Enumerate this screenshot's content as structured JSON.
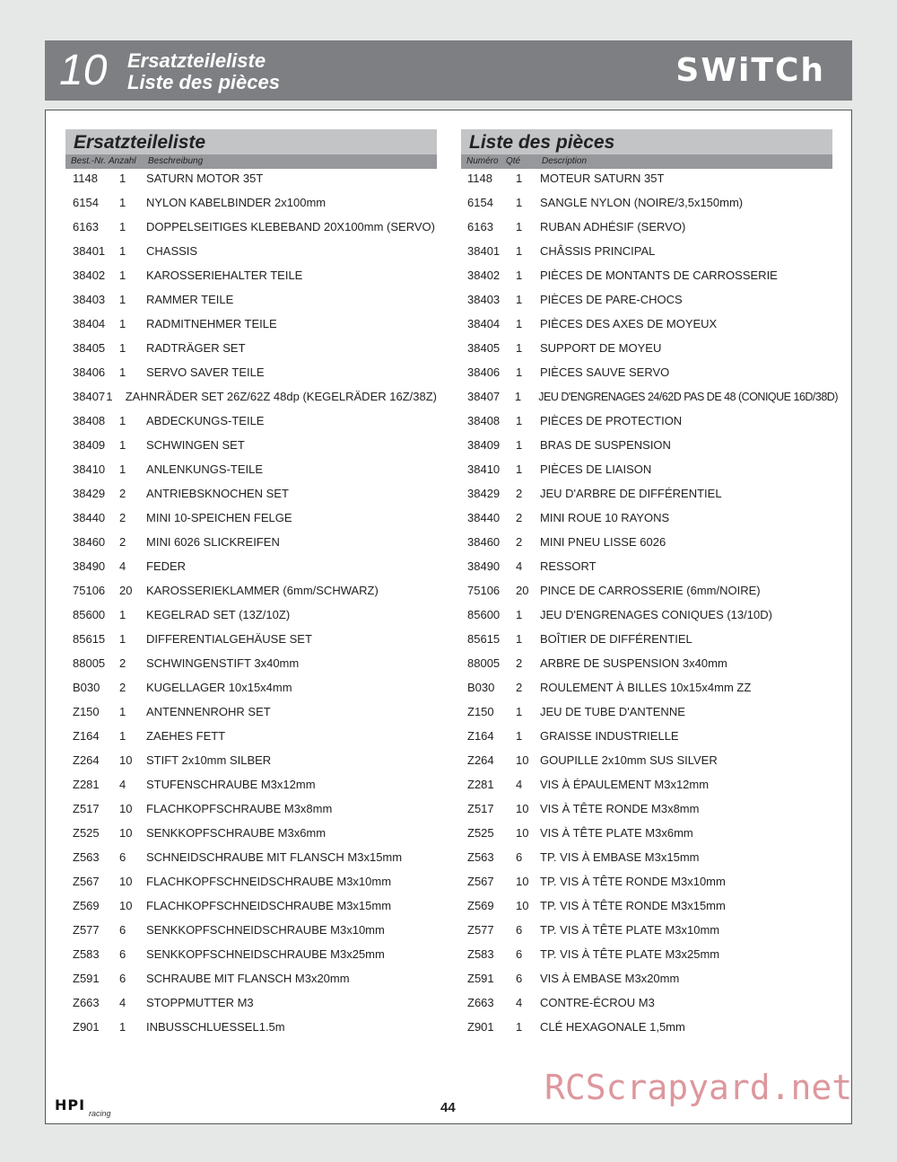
{
  "header": {
    "chapter_number": "10",
    "title_de": "Ersatzteileliste",
    "title_fr": "Liste des pièces",
    "brand": "SWiTCh"
  },
  "german": {
    "section_title": "Ersatzteileliste",
    "columns": [
      "Best.-Nr.",
      "Anzahl",
      "Beschreibung"
    ],
    "rows": [
      [
        "1148",
        "1",
        "SATURN MOTOR 35T"
      ],
      [
        "6154",
        "1",
        "NYLON KABELBINDER 2x100mm"
      ],
      [
        "6163",
        "1",
        "DOPPELSEITIGES KLEBEBAND 20X100mm (SERVO)"
      ],
      [
        "38401",
        "1",
        "CHASSIS"
      ],
      [
        "38402",
        "1",
        "KAROSSERIEHALTER TEILE"
      ],
      [
        "38403",
        "1",
        "RAMMER TEILE"
      ],
      [
        "38404",
        "1",
        "RADMITNEHMER TEILE"
      ],
      [
        "38405",
        "1",
        "RADTRÄGER SET"
      ],
      [
        "38406",
        "1",
        "SERVO SAVER TEILE"
      ],
      [
        "38407",
        "1",
        "ZAHNRÄDER SET 26Z/62Z 48dp (KEGELRÄDER 16Z/38Z)"
      ],
      [
        "38408",
        "1",
        "ABDECKUNGS-TEILE"
      ],
      [
        "38409",
        "1",
        "SCHWINGEN SET"
      ],
      [
        "38410",
        "1",
        "ANLENKUNGS-TEILE"
      ],
      [
        "38429",
        "2",
        "ANTRIEBSKNOCHEN SET"
      ],
      [
        "38440",
        "2",
        "MINI 10-SPEICHEN FELGE"
      ],
      [
        "38460",
        "2",
        "MINI 6026 SLICKREIFEN"
      ],
      [
        "38490",
        "4",
        "FEDER"
      ],
      [
        "75106",
        "20",
        "KAROSSERIEKLAMMER (6mm/SCHWARZ)"
      ],
      [
        "85600",
        "1",
        "KEGELRAD SET (13Z/10Z)"
      ],
      [
        "85615",
        "1",
        "DIFFERENTIALGEHÄUSE SET"
      ],
      [
        "88005",
        "2",
        "SCHWINGENSTIFT 3x40mm"
      ],
      [
        "B030",
        "2",
        "KUGELLAGER 10x15x4mm"
      ],
      [
        "Z150",
        "1",
        "ANTENNENROHR SET"
      ],
      [
        "Z164",
        "1",
        "ZAEHES FETT"
      ],
      [
        "Z264",
        "10",
        "STIFT 2x10mm SILBER"
      ],
      [
        "Z281",
        "4",
        "STUFENSCHRAUBE M3x12mm"
      ],
      [
        "Z517",
        "10",
        "FLACHKOPFSCHRAUBE M3x8mm"
      ],
      [
        "Z525",
        "10",
        "SENKKOPFSCHRAUBE M3x6mm"
      ],
      [
        "Z563",
        "6",
        "SCHNEIDSCHRAUBE MIT FLANSCH M3x15mm"
      ],
      [
        "Z567",
        "10",
        "FLACHKOPFSCHNEIDSCHRAUBE M3x10mm"
      ],
      [
        "Z569",
        "10",
        "FLACHKOPFSCHNEIDSCHRAUBE M3x15mm"
      ],
      [
        "Z577",
        "6",
        "SENKKOPFSCHNEIDSCHRAUBE M3x10mm"
      ],
      [
        "Z583",
        "6",
        "SENKKOPFSCHNEIDSCHRAUBE M3x25mm"
      ],
      [
        "Z591",
        "6",
        "SCHRAUBE MIT FLANSCH M3x20mm"
      ],
      [
        "Z663",
        "4",
        "STOPPMUTTER M3"
      ],
      [
        "Z901",
        "1",
        "INBUSSCHLUESSEL1.5m"
      ]
    ]
  },
  "french": {
    "section_title": "Liste des pièces",
    "columns": [
      "Numéro",
      "Qté",
      "Description"
    ],
    "rows": [
      [
        "1148",
        "1",
        "MOTEUR SATURN 35T"
      ],
      [
        "6154",
        "1",
        "SANGLE NYLON (NOIRE/3,5x150mm)"
      ],
      [
        "6163",
        "1",
        "RUBAN ADHÉSIF (SERVO)"
      ],
      [
        "38401",
        "1",
        "CHÂSSIS PRINCIPAL"
      ],
      [
        "38402",
        "1",
        "PIÈCES DE MONTANTS DE CARROSSERIE"
      ],
      [
        "38403",
        "1",
        "PIÈCES DE PARE-CHOCS"
      ],
      [
        "38404",
        "1",
        "PIÈCES DES AXES DE MOYEUX"
      ],
      [
        "38405",
        "1",
        "SUPPORT DE MOYEU"
      ],
      [
        "38406",
        "1",
        "PIÈCES SAUVE SERVO"
      ],
      [
        "38407",
        "1",
        "JEU D'ENGRENAGES 24/62D PAS DE 48 (CONIQUE 16D/38D)"
      ],
      [
        "38408",
        "1",
        "PIÈCES DE PROTECTION"
      ],
      [
        "38409",
        "1",
        "BRAS DE SUSPENSION"
      ],
      [
        "38410",
        "1",
        "PIÈCES DE LIAISON"
      ],
      [
        "38429",
        "2",
        "JEU D'ARBRE DE DIFFÉRENTIEL"
      ],
      [
        "38440",
        "2",
        "MINI ROUE 10 RAYONS"
      ],
      [
        "38460",
        "2",
        "MINI PNEU LISSE 6026"
      ],
      [
        "38490",
        "4",
        "RESSORT"
      ],
      [
        "75106",
        "20",
        "PINCE DE CARROSSERIE (6mm/NOIRE)"
      ],
      [
        "85600",
        "1",
        "JEU D'ENGRENAGES CONIQUES (13/10D)"
      ],
      [
        "85615",
        "1",
        "BOÎTIER DE DIFFÉRENTIEL"
      ],
      [
        "88005",
        "2",
        "ARBRE DE SUSPENSION 3x40mm"
      ],
      [
        "B030",
        "2",
        "ROULEMENT À BILLES 10x15x4mm ZZ"
      ],
      [
        "Z150",
        "1",
        "JEU DE TUBE D'ANTENNE"
      ],
      [
        "Z164",
        "1",
        "GRAISSE INDUSTRIELLE"
      ],
      [
        "Z264",
        "10",
        "GOUPILLE 2x10mm SUS SILVER"
      ],
      [
        "Z281",
        "4",
        "VIS À ÉPAULEMENT M3x12mm"
      ],
      [
        "Z517",
        "10",
        "VIS À TÊTE RONDE M3x8mm"
      ],
      [
        "Z525",
        "10",
        "VIS À TÊTE PLATE M3x6mm"
      ],
      [
        "Z563",
        "6",
        "TP. VIS À EMBASE M3x15mm"
      ],
      [
        "Z567",
        "10",
        "TP. VIS À TÊTE RONDE M3x10mm"
      ],
      [
        "Z569",
        "10",
        "TP. VIS À TÊTE RONDE M3x15mm"
      ],
      [
        "Z577",
        "6",
        "TP. VIS À TÊTE PLATE M3x10mm"
      ],
      [
        "Z583",
        "6",
        "TP. VIS À TÊTE PLATE M3x25mm"
      ],
      [
        "Z591",
        "6",
        "VIS À EMBASE M3x20mm"
      ],
      [
        "Z663",
        "4",
        "CONTRE-ÉCROU M3"
      ],
      [
        "Z901",
        "1",
        "CLÉ HEXAGONALE 1,5mm"
      ]
    ]
  },
  "footer": {
    "hpi_logo": "HPI",
    "hpi_sub": "racing",
    "page_number": "44",
    "watermark": "RCScrapyard.net"
  }
}
